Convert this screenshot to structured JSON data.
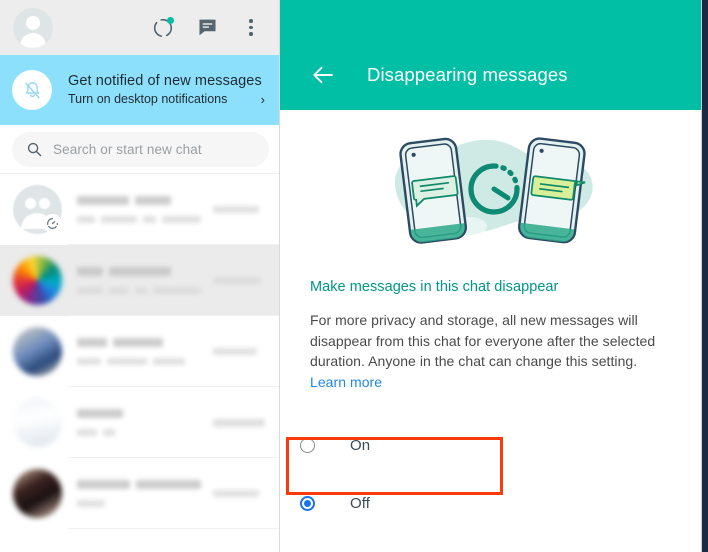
{
  "sidebar": {
    "header": {
      "avatar_name": "profile-avatar",
      "icons": [
        {
          "name": "status-ring-icon",
          "label": "Status"
        },
        {
          "name": "new-chat-icon",
          "label": "New chat"
        },
        {
          "name": "menu-dots-icon",
          "label": "Menu"
        }
      ]
    },
    "notification_banner": {
      "title": "Get notified of new messages",
      "subtitle": "Turn on desktop notifications",
      "chevron": "›",
      "icon": "bell-muted-icon",
      "background": "#8de0fc"
    },
    "search": {
      "placeholder": "Search or start new chat",
      "icon": "search-icon"
    },
    "chats": [
      {
        "avatar": "grp",
        "selected": false,
        "has_timer_badge": true
      },
      {
        "avatar": "rainbow",
        "selected": true,
        "has_timer_badge": false
      },
      {
        "avatar": "photo1",
        "selected": false,
        "has_timer_badge": false
      },
      {
        "avatar": "photo2",
        "selected": false,
        "has_timer_badge": false
      },
      {
        "avatar": "photo3",
        "selected": false,
        "has_timer_badge": false
      }
    ]
  },
  "panel": {
    "header": {
      "title": "Disappearing messages",
      "back_icon": "back-arrow-icon",
      "background": "#00bfa5"
    },
    "illustration": {
      "name": "disappearing-messages-illustration",
      "elements": [
        "phone-left",
        "phone-right",
        "timer-icon",
        "cloud",
        "message-bubble"
      ]
    },
    "section_heading": "Make messages in this chat disappear",
    "description": "For more privacy and storage, all new messages will disappear from this chat for everyone after the selected duration. Anyone in the chat can change this setting.",
    "learn_more": "Learn more",
    "options": [
      {
        "label": "On",
        "selected": false,
        "highlighted": true
      },
      {
        "label": "Off",
        "selected": true,
        "highlighted": false
      }
    ],
    "highlight_color": "#f93b0c"
  },
  "colors": {
    "teal": "#00bfa5",
    "heading_teal": "#009688",
    "link_blue": "#1e88e5",
    "radio_blue": "#1a73e8",
    "banner_blue": "#8de0fc",
    "annotation_red": "#f93b0c"
  }
}
